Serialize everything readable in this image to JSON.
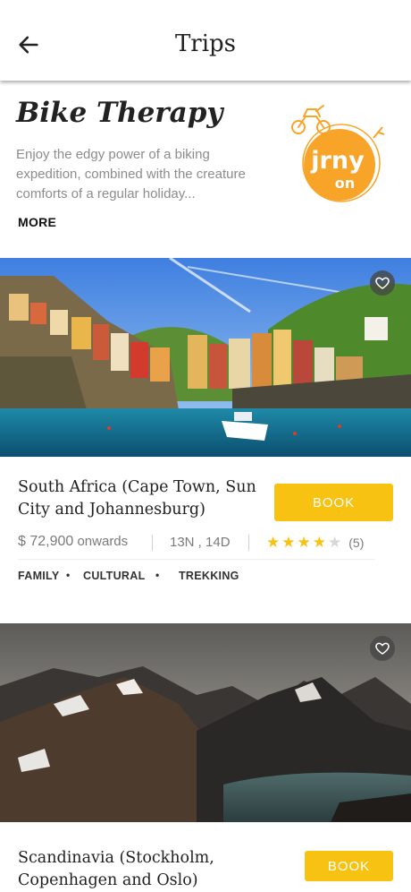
{
  "header": {
    "title": "Trips",
    "back_icon": "arrow-left-icon"
  },
  "hero": {
    "title": "Bike Therapy",
    "description": "Enjoy the edgy power of a biking expedition, combined with the creature comforts of a regular holiday...",
    "more_label": "MORE",
    "logo_text_top": "jrny",
    "logo_text_bottom": "on",
    "brand_color": "#f7a428"
  },
  "trips": [
    {
      "name": "South Africa (Cape Town, Sun City and Johannesburg)",
      "book_label": "BOOK",
      "price": "$ 72,900",
      "price_suffix": "onwards",
      "duration": "13N , 14D",
      "rating": 4,
      "rating_max": 5,
      "reviews": "(5)",
      "tags": [
        "FAMILY",
        "CULTURAL",
        "TREKKING"
      ],
      "image": "coastal-village-harbor"
    },
    {
      "name": "Scandinavia (Stockholm, Copenhagen and Oslo)",
      "book_label": "BOOK",
      "image": "snowy-mountains-fjord"
    }
  ],
  "colors": {
    "accent": "#f7c212",
    "star_on": "#f7c212",
    "star_off": "#d6d6d6"
  }
}
